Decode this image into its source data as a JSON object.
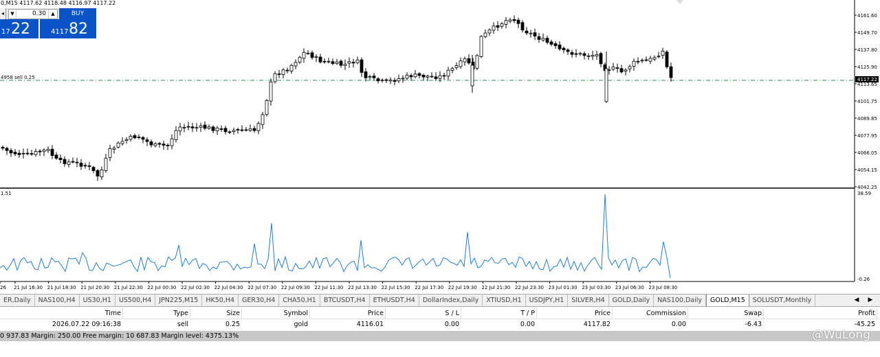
{
  "chart": {
    "symbol_info": "0,M15  4117.62 4118.48 4116.97 4117.22",
    "current_price": "4117.22",
    "price_levels": [
      "4161.60",
      "4149.70",
      "4137.80",
      "4125.90",
      "4113.65",
      "4101.75",
      "4089.85",
      "4077.95",
      "4066.05",
      "4054.15",
      "4042.25"
    ],
    "order_line_label": "4958 sell 0.25",
    "time_labels": [
      "26",
      "21 Jul 16:30",
      "21 Jul 18:30",
      "21 Jul 20:30",
      "21 Jul 22:30",
      "22 Jul 00:30",
      "22 Jul 02:30",
      "22 Jul 04:30",
      "22 Jul 07:30",
      "22 Jul 09:30",
      "22 Jul 11:30",
      "22 Jul 13:30",
      "22 Jul 15:30",
      "22 Jul 17:30",
      "22 Jul 19:30",
      "22 Jul 21:30",
      "22 Jul 23:30",
      "23 Jul 01:30",
      "23 Jul 03:30",
      "23 Jul 06:30",
      "23 Jul 08:30"
    ],
    "indicator_left_label": "1.51",
    "indicator_max": "38.59",
    "indicator_min": "-0.26",
    "up_color": "#ffffff",
    "down_color": "#000000",
    "indicator_color": "#1e7fd9",
    "order_line_color": "#2e8b57"
  },
  "trade_panel": {
    "lot_value": "0.30",
    "buy_label": "BUY",
    "sell_price_small": "17",
    "sell_price_big": "22",
    "buy_price_small": "4117",
    "buy_price_big": "82",
    "color": "#0a54c8"
  },
  "tabs": [
    "ER,Daily",
    "NAS100,H4",
    "US30,H1",
    "US500,H4",
    "JPN225,M15",
    "HK50,H4",
    "GER30,H4",
    "CHA50,H1",
    "BTCUSDT,H4",
    "ETHUSDT,H4",
    "DollarIndex,Daily",
    "XTIUSD,H1",
    "USDJPY,H1",
    "SILVER,H4",
    "GOLD,Daily",
    "NAS100,Daily",
    "GOLD,M15",
    "SOLUSDT,Monthly"
  ],
  "active_tab": "GOLD,M15",
  "trade_table": {
    "headers": [
      "Time",
      "Type",
      "Size",
      "Symbol",
      "Price",
      "S / L",
      "T / P",
      "Price",
      "Commission",
      "Swap",
      "Profit"
    ],
    "row": [
      "2026.07.22 09:16:38",
      "sell",
      "0.25",
      "gold",
      "4116.01",
      "0.00",
      "0.00",
      "4117.82",
      "0.00",
      "-6.43",
      "-45.25"
    ],
    "balance_line": "0 937.83  Margin: 250.00  Free margin: 10 687.83  Margin level: 4375.13%"
  },
  "watermark": "@WuLong"
}
